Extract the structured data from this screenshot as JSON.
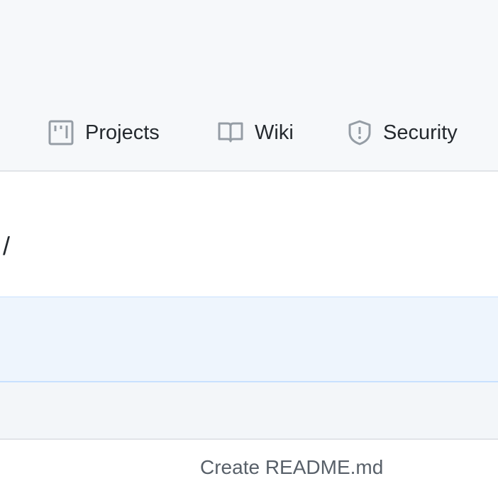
{
  "nav": {
    "tabs": [
      {
        "label": "Projects",
        "icon": "project-icon"
      },
      {
        "label": "Wiki",
        "icon": "book-icon"
      },
      {
        "label": "Security",
        "icon": "shield-icon"
      }
    ]
  },
  "breadcrumb": {
    "separator": "/"
  },
  "latest_commit": {
    "message": "Create README.md"
  },
  "colors": {
    "icon": "#959da5",
    "text": "#24292e",
    "muted": "#586069"
  }
}
